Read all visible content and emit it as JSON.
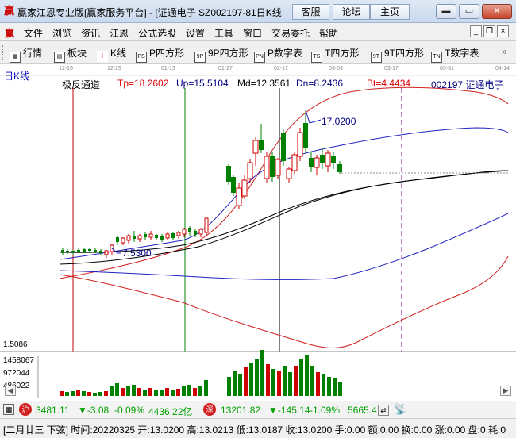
{
  "window": {
    "title": "赢家江恩专业版[赢家服务平台] - [证通电子   SZ002197-81日K线",
    "btn_service": "客服",
    "btn_forum": "论坛",
    "btn_home": "主页"
  },
  "menu": [
    "文件",
    "浏览",
    "资讯",
    "江恩",
    "公式选股",
    "设置",
    "工具",
    "窗口",
    "交易委托",
    "帮助"
  ],
  "toolbar": [
    {
      "icon": "grid-icon",
      "label": "行情"
    },
    {
      "icon": "blocks-icon",
      "label": "板块"
    },
    {
      "icon": "candle-icon",
      "label": "K线"
    },
    {
      "icon": "p-square-icon",
      "label": "P四方形",
      "glyph": "PS"
    },
    {
      "icon": "9p-square-icon",
      "label": "9P四方形",
      "glyph": "9P"
    },
    {
      "icon": "p-number-table-icon",
      "label": "P数字表",
      "glyph": "PN"
    },
    {
      "icon": "t-square-icon",
      "label": "T四方形",
      "glyph": "TS"
    },
    {
      "icon": "9t-square-icon",
      "label": "9T四方形",
      "glyph": "9T"
    },
    {
      "icon": "t-number-table-icon",
      "label": "T数字表",
      "glyph": "TN"
    }
  ],
  "chart": {
    "period_label": "日K线",
    "dates": [
      "12-15",
      "12-29",
      "01-13",
      "01-27",
      "02-17",
      "03-03",
      "03-17",
      "03-31",
      "04-14"
    ],
    "indicator_name": "极反通道",
    "tp": "Tp=18.2602",
    "up": "Up=15.5104",
    "md": "Md=12.3561",
    "dn": "Dn=8.2436",
    "bt": "Bt=4.4434",
    "stock": "002197  证通电子",
    "high_label": "17.0200",
    "low_label": "7.5300",
    "indicator_axis_value": "1.5086",
    "volume_axis": [
      "1458067",
      "972044",
      "486022"
    ],
    "colors": {
      "up_candle": "#d00000",
      "down_candle": "#008000",
      "upper_band": "#d02020",
      "mid_band": "#000000",
      "blue_band": "#2020c0"
    }
  },
  "chart_data": {
    "type": "candlestick",
    "dates": [
      "12-15",
      "12-29",
      "01-13",
      "01-27",
      "02-17",
      "03-03",
      "03-17",
      "03-31",
      "04-14"
    ],
    "price_high": 17.02,
    "price_low": 7.53,
    "last_close": 13.02,
    "volume_ticks": [
      1458067,
      972044,
      486022
    ]
  },
  "status": {
    "sh_index": "3481.11",
    "sh_change": "▼-3.08",
    "sh_pct": "-0.09%",
    "sh_amount": "4436.22亿",
    "sz_index": "13201.82",
    "sz_change": "▼-145.14",
    "sz_pct": "-1.09%",
    "sz_amount": "5665.4"
  },
  "quote": "[二月廿三  下弦] 时间:20220325 开:13.0200 高:13.0213 低:13.0187 收:13.0200 手:0.00 额:0.00 换:0.00 涨:0.00 盘:0 耗:0"
}
